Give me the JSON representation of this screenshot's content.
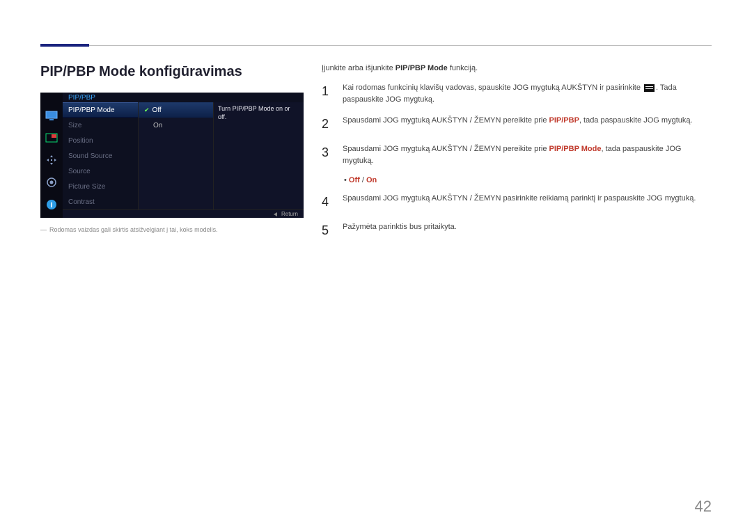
{
  "page_number": "42",
  "title": "PIP/PBP Mode konfigūravimas",
  "osd": {
    "header": "PIP/PBP",
    "menu_items": [
      "PIP/PBP Mode",
      "Size",
      "Position",
      "Sound Source",
      "Source",
      "Picture Size",
      "Contrast"
    ],
    "selected_menu_index": 0,
    "options": [
      "Off",
      "On"
    ],
    "selected_option_index": 0,
    "help_text": "Turn PIP/PBP Mode on or off.",
    "return_label": "Return"
  },
  "caption_prefix": "―",
  "caption": "Rodomas vaizdas gali skirtis atsižvelgiant į tai, koks modelis.",
  "intro": {
    "pre": "Įjunkite arba išjunkite ",
    "kw": "PIP/PBP Mode",
    "post": " funkciją."
  },
  "steps": {
    "s1a": "Kai rodomas funkcinių klavišų vadovas, spauskite JOG mygtuką AUKŠTYN ir pasirinkite ",
    "s1b": ". Tada paspauskite JOG mygtuką.",
    "s2a": "Spausdami JOG mygtuką AUKŠTYN / ŽEMYN pereikite prie ",
    "s2kw": "PIP/PBP",
    "s2b": ", tada paspauskite JOG mygtuką.",
    "s3a": "Spausdami JOG mygtuką AUKŠTYN / ŽEMYN pereikite prie ",
    "s3kw": "PIP/PBP Mode",
    "s3b": ", tada paspauskite JOG mygtuką.",
    "s4": "Spausdami JOG mygtuką AUKŠTYN / ŽEMYN pasirinkite reikiamą parinktį ir paspauskite JOG mygtuką.",
    "s5": "Pažymėta parinktis bus pritaikyta."
  },
  "bullet": {
    "off": "Off",
    "sep": " / ",
    "on": "On"
  }
}
